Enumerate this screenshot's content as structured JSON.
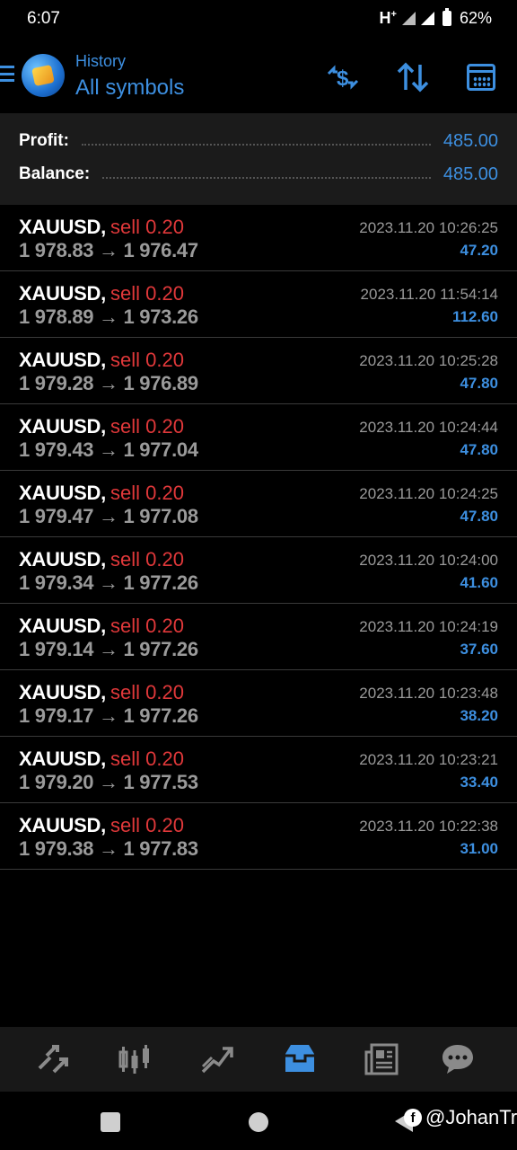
{
  "status_bar": {
    "time": "6:07",
    "network": "H",
    "network_plus": "+",
    "battery": "62%"
  },
  "header": {
    "subtitle": "History",
    "title": "All symbols",
    "icons": [
      "menu-icon",
      "currency-exchange-icon",
      "sort-icon",
      "calendar-icon"
    ]
  },
  "summary": {
    "profit_label": "Profit:",
    "profit_value": "485.00",
    "balance_label": "Balance:",
    "balance_value": "485.00"
  },
  "trades": [
    {
      "symbol": "XAUUSD,",
      "type": "sell 0.20",
      "prices": "1 978.83 → 1 976.47",
      "time": "2023.11.20 10:26:25",
      "profit": "47.20"
    },
    {
      "symbol": "XAUUSD,",
      "type": "sell 0.20",
      "prices": "1 978.89 → 1 973.26",
      "time": "2023.11.20 11:54:14",
      "profit": "112.60"
    },
    {
      "symbol": "XAUUSD,",
      "type": "sell 0.20",
      "prices": "1 979.28 → 1 976.89",
      "time": "2023.11.20 10:25:28",
      "profit": "47.80"
    },
    {
      "symbol": "XAUUSD,",
      "type": "sell 0.20",
      "prices": "1 979.43 → 1 977.04",
      "time": "2023.11.20 10:24:44",
      "profit": "47.80"
    },
    {
      "symbol": "XAUUSD,",
      "type": "sell 0.20",
      "prices": "1 979.47 → 1 977.08",
      "time": "2023.11.20 10:24:25",
      "profit": "47.80"
    },
    {
      "symbol": "XAUUSD,",
      "type": "sell 0.20",
      "prices": "1 979.34 → 1 977.26",
      "time": "2023.11.20 10:24:00",
      "profit": "41.60"
    },
    {
      "symbol": "XAUUSD,",
      "type": "sell 0.20",
      "prices": "1 979.14 → 1 977.26",
      "time": "2023.11.20 10:24:19",
      "profit": "37.60"
    },
    {
      "symbol": "XAUUSD,",
      "type": "sell 0.20",
      "prices": "1 979.17 → 1 977.26",
      "time": "2023.11.20 10:23:48",
      "profit": "38.20"
    },
    {
      "symbol": "XAUUSD,",
      "type": "sell 0.20",
      "prices": "1 979.20 → 1 977.53",
      "time": "2023.11.20 10:23:21",
      "profit": "33.40"
    },
    {
      "symbol": "XAUUSD,",
      "type": "sell 0.20",
      "prices": "1 979.38 → 1 977.83",
      "time": "2023.11.20 10:22:38",
      "profit": "31.00"
    }
  ],
  "bottom_nav": {
    "items": [
      "quotes-icon",
      "chart-icon",
      "trade-icon",
      "history-icon",
      "news-icon",
      "chat-icon"
    ],
    "active": "history-icon"
  },
  "watermark": {
    "text": "@JohanTr"
  },
  "colors": {
    "accent": "#3d8fe0",
    "sell": "#e0383a",
    "muted": "#9a9a9a"
  }
}
